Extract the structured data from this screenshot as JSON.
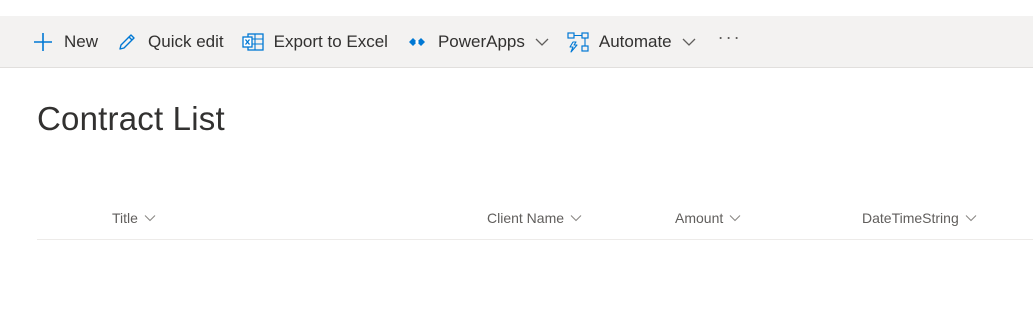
{
  "toolbar": {
    "new_label": "New",
    "quick_edit_label": "Quick edit",
    "export_label": "Export to Excel",
    "powerapps_label": "PowerApps",
    "automate_label": "Automate",
    "more_label": "···",
    "accent_color": "#0078d4"
  },
  "page": {
    "title": "Contract List"
  },
  "list": {
    "columns": [
      {
        "label": "Title"
      },
      {
        "label": "Client Name"
      },
      {
        "label": "Amount"
      },
      {
        "label": "DateTimeString"
      }
    ]
  }
}
